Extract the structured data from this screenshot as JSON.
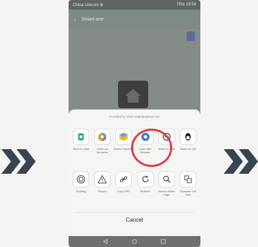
{
  "status_bar": {
    "carrier": "China Unicom ⊕",
    "battery": "75%",
    "time": "16:54"
  },
  "app_bar": {
    "back_glyph": "‹",
    "title": "Smart one"
  },
  "share_sheet": {
    "powered_by": "Provided by share.tegtegtegtegt.com",
    "row1": [
      {
        "label": "Send to Chat",
        "icon": "chat-send-icon",
        "color": "#22a86a"
      },
      {
        "label": "Share on Moments",
        "icon": "moments-icon",
        "color": "#e7a52d"
      },
      {
        "label": "Add to Favorites",
        "icon": "favorite-cube-icon",
        "color": "#f2b62c"
      },
      {
        "label": "Open with Browser",
        "icon": "browser-icon",
        "color": "#3b7bd4"
      },
      {
        "label": "Share to Note",
        "icon": "note-icon",
        "color": "#5b5b5b"
      },
      {
        "label": "Share on QQ",
        "icon": "qq-penguin-icon",
        "color": "#111111"
      }
    ],
    "row2": [
      {
        "label": "Floating",
        "icon": "floating-icon"
      },
      {
        "label": "Report",
        "icon": "warning-icon"
      },
      {
        "label": "Copy URL",
        "icon": "link-icon"
      },
      {
        "label": "Refresh",
        "icon": "refresh-icon"
      },
      {
        "label": "Search Within Page",
        "icon": "search-icon"
      },
      {
        "label": "Translate Full Text",
        "icon": "translate-icon"
      }
    ],
    "cancel_label": "Cancel"
  },
  "highlight_color": "#e03a45",
  "arrow_color": "#3a4350"
}
